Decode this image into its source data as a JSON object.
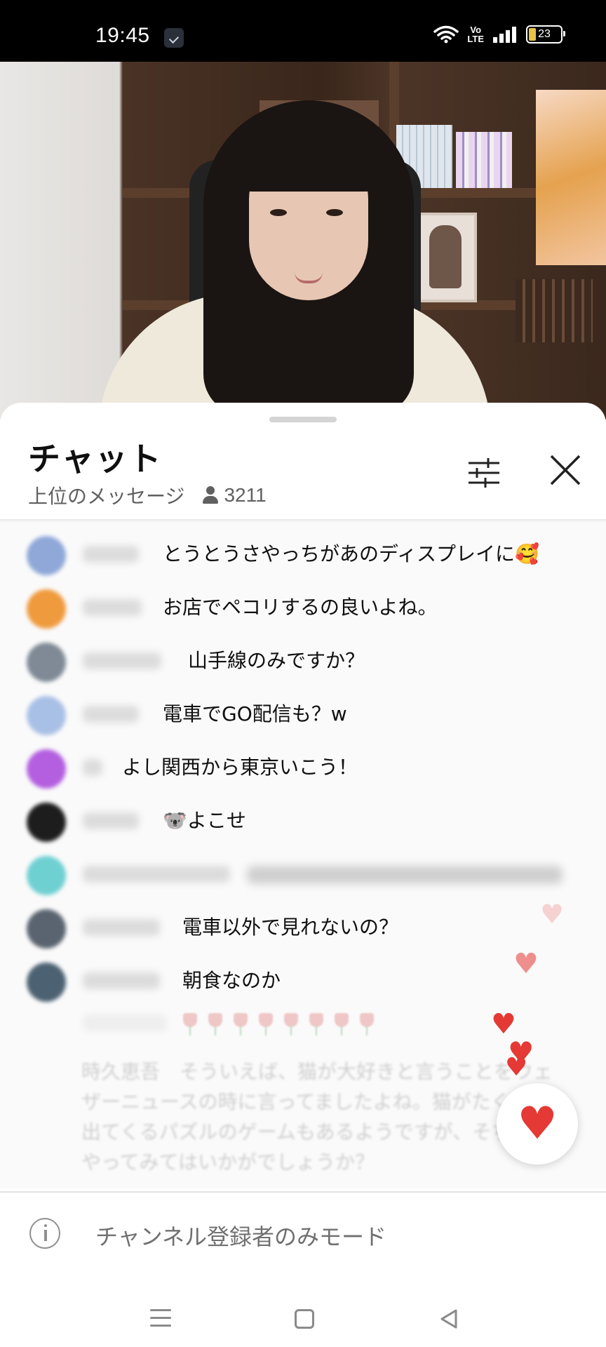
{
  "status_bar": {
    "time": "19:45",
    "volte_top": "Vo",
    "volte_bottom": "LTE",
    "battery": "23"
  },
  "chat": {
    "title": "チャット",
    "subtitle": "上位のメッセージ",
    "viewer_count": "3211"
  },
  "messages": [
    {
      "text": "とうとうさやっちがあのディスプレイに🥰",
      "avatar_color": "#8fa8d8"
    },
    {
      "text": "お店でペコリするの良いよね。",
      "avatar_color": "#f09a3e"
    },
    {
      "text": "山手線のみですか？",
      "avatar_color": "#7f8a96"
    },
    {
      "text": "電車でGO配信も？w",
      "avatar_color": "#a9c0e6"
    },
    {
      "text": "よし関西から東京いこう！",
      "avatar_color": "#b45fe0"
    },
    {
      "text": "🐨よこせ",
      "avatar_color": "#1d1d1d"
    },
    {
      "text": "",
      "avatar_color": "#6fd0d2"
    },
    {
      "text": "電車以外で見れないの？",
      "avatar_color": "#5a6470"
    },
    {
      "text": "朝食なのか",
      "avatar_color": "#4c6272"
    }
  ],
  "faded_message": "時久恵吾　そういえば、猫が大好きと言うことをウェザーニュースの時に言ってましたよね。猫がたくさん出てくるパズルのゲームもあるようですが、そちらもやってみてはいかがでしょうか？",
  "input": {
    "placeholder": "チャンネル登録者のみモード"
  },
  "icons": {
    "filter": "sliders-icon",
    "close": "close-icon",
    "heart": "heart-icon",
    "info": "info-icon"
  },
  "colors": {
    "heart": "#e53935",
    "text": "#0f0f0f",
    "muted": "#606060"
  }
}
